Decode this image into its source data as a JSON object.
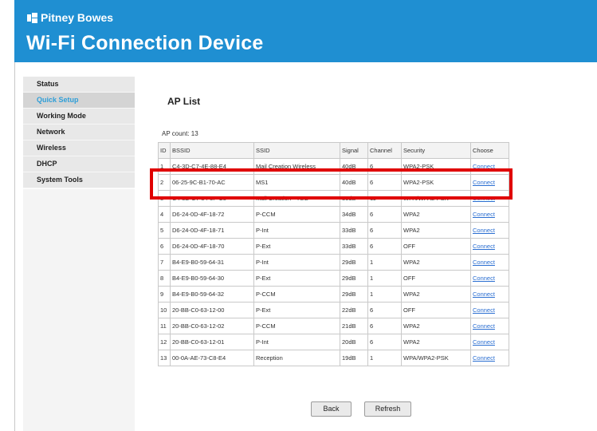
{
  "header": {
    "brand": "Pitney Bowes",
    "title": "Wi-Fi Connection Device"
  },
  "sidebar": {
    "items": [
      {
        "label": "Status",
        "active": false
      },
      {
        "label": "Quick Setup",
        "active": true
      },
      {
        "label": "Working Mode",
        "active": false
      },
      {
        "label": "Network",
        "active": false
      },
      {
        "label": "Wireless",
        "active": false
      },
      {
        "label": "DHCP",
        "active": false
      },
      {
        "label": "System Tools",
        "active": false
      }
    ]
  },
  "main": {
    "title": "AP List",
    "ap_count_label": "AP count:",
    "ap_count": "13",
    "columns": [
      "ID",
      "BSSID",
      "SSID",
      "Signal",
      "Channel",
      "Security",
      "Choose"
    ],
    "rows": [
      [
        "1",
        "C4-3D-C7-4E-88-E4",
        "Mail Creation Wireless",
        "40dB",
        "6",
        "WPA2-PSK",
        "Connect"
      ],
      [
        "2",
        "06-25-9C-B1-70-AC",
        "MS1",
        "40dB",
        "6",
        "WPA2-PSK",
        "Connect"
      ],
      [
        "3",
        "C4-3D-C7-34-5F-C5",
        "Mail Creation - TSG",
        "36dB",
        "11",
        "WPA/WPA2-PSK",
        "Connect"
      ],
      [
        "4",
        "D6-24-0D-4F-18-72",
        "P-CCM",
        "34dB",
        "6",
        "WPA2",
        "Connect"
      ],
      [
        "5",
        "D6-24-0D-4F-18-71",
        "P-Int",
        "33dB",
        "6",
        "WPA2",
        "Connect"
      ],
      [
        "6",
        "D6-24-0D-4F-18-70",
        "P-Ext",
        "33dB",
        "6",
        "OFF",
        "Connect"
      ],
      [
        "7",
        "B4-E9-B0-59-64-31",
        "P-Int",
        "29dB",
        "1",
        "WPA2",
        "Connect"
      ],
      [
        "8",
        "B4-E9-B0-59-64-30",
        "P-Ext",
        "29dB",
        "1",
        "OFF",
        "Connect"
      ],
      [
        "9",
        "B4-E9-B0-59-64-32",
        "P-CCM",
        "29dB",
        "1",
        "WPA2",
        "Connect"
      ],
      [
        "10",
        "20-BB-C0-63-12-00",
        "P-Ext",
        "22dB",
        "6",
        "OFF",
        "Connect"
      ],
      [
        "11",
        "20-BB-C0-63-12-02",
        "P-CCM",
        "21dB",
        "6",
        "WPA2",
        "Connect"
      ],
      [
        "12",
        "20-BB-C0-63-12-01",
        "P-Int",
        "20dB",
        "6",
        "WPA2",
        "Connect"
      ],
      [
        "13",
        "00-0A-AE-73-C8-E4",
        "Reception",
        "19dB",
        "1",
        "WPA/WPA2-PSK",
        "Connect"
      ]
    ],
    "back_label": "Back",
    "refresh_label": "Refresh"
  },
  "colors": {
    "header_bg": "#1f8fd2",
    "highlight": "#e00000",
    "link": "#2a6ed1",
    "active_nav": "#2f9fd8"
  }
}
